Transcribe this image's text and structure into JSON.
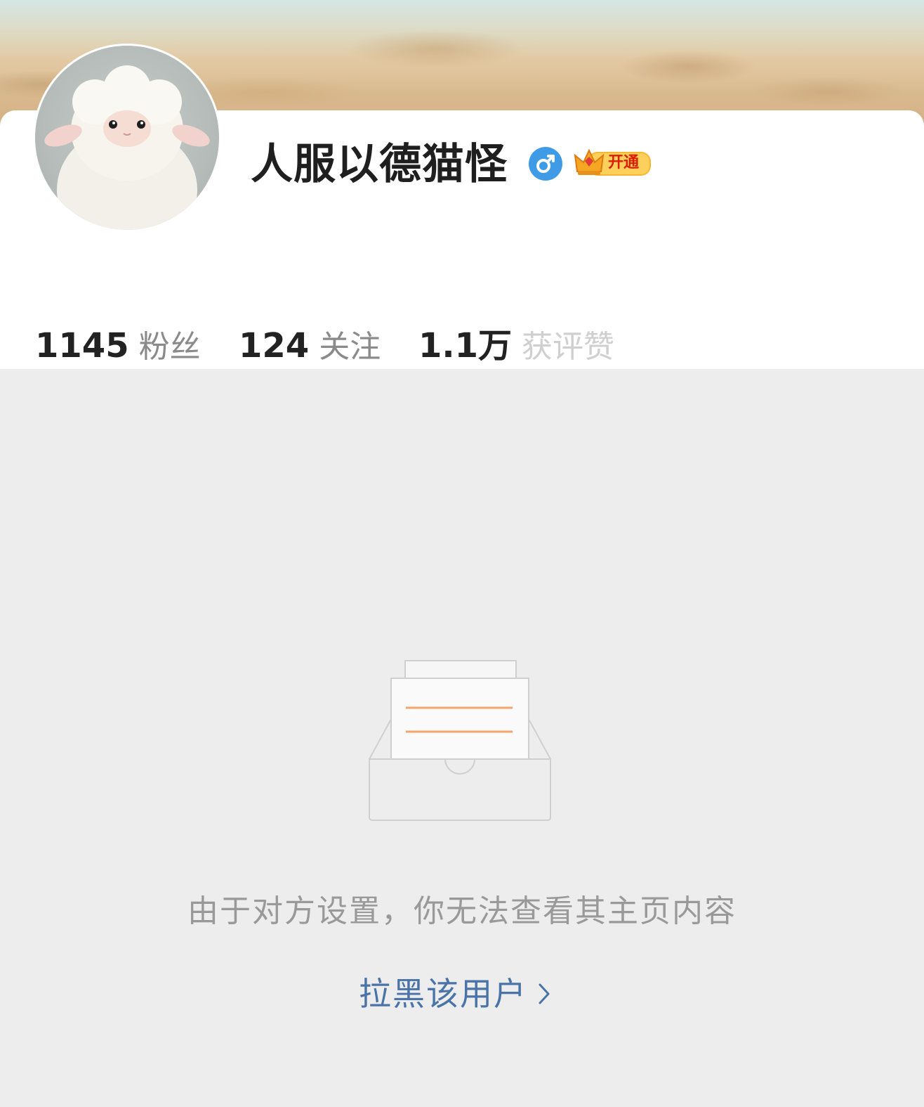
{
  "profile": {
    "username": "人服以德猫怪",
    "gender_icon": "male-icon",
    "vip_badge_label": "开通",
    "stats": [
      {
        "value": "1145",
        "label": "粉丝"
      },
      {
        "value": "124",
        "label": "关注"
      },
      {
        "value": "1.1万",
        "label": "获评赞"
      }
    ]
  },
  "empty_state": {
    "illustration_icon": "empty-inbox-icon",
    "message": "由于对方设置，你无法查看其主页内容",
    "block_link_label": "拉黑该用户"
  },
  "colors": {
    "page_background": "#ededed",
    "link": "#4a74a8",
    "gender_badge": "#3f9be6",
    "vip_gold": "#f6b731",
    "empty_line_accent": "#f3a46c"
  }
}
